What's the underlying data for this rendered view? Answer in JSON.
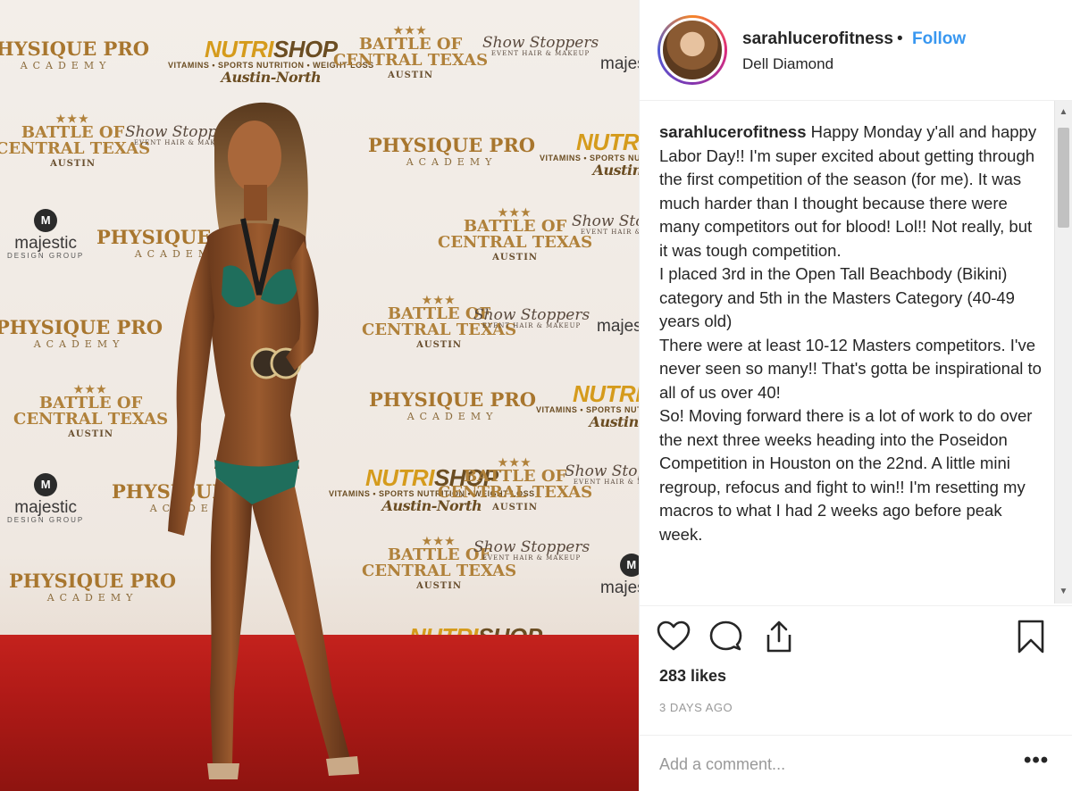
{
  "post": {
    "username": "sarahlucerofitness",
    "separator": "•",
    "follow_label": "Follow",
    "location": "Dell Diamond",
    "caption_user": "sarahlucerofitness",
    "caption_lines": [
      "Happy Monday y'all and happy Labor Day!! I'm super excited about getting through the first competition of the season (for me). It was much harder than I thought because there were many competitors out for blood! Lol!! Not really, but it was tough competition.",
      "I placed 3rd in the Open Tall Beachbody (Bikini) category and 5th in the Masters Category (40-49 years old)",
      "There were at least 10-12 Masters competitors. I've never seen so many!! That's gotta be inspirational to all of us over 40!",
      "So! Moving forward there is a lot of work to do over the next three weeks heading into the Poseidon Competition in Houston on the 22nd. A little mini regroup, refocus and fight to win!! I'm resetting my macros to what I had 2 weeks ago before peak week."
    ],
    "likes": "283 likes",
    "timestamp": "3 DAYS AGO",
    "comment_placeholder": "Add a comment...",
    "more_label": "•••"
  },
  "backdrop_logos": {
    "physique": "PHYSIQUE PRO",
    "physique_sub": "ACADEMY",
    "nutri_a": "NUTRI",
    "nutri_b": "SHOP",
    "nutri_sub": "VITAMINS • SPORTS NUTRITION • WEIGHT LOSS",
    "nutri_city": "Austin-North",
    "battle_stars": "★★★",
    "battle_line1": "BATTLE OF",
    "battle_line2": "CENTRAL TEXAS",
    "battle_sub": "AUSTIN",
    "show": "Show Stoppers",
    "show_sub": "EVENT HAIR & MAKEUP",
    "majestic": "majestic",
    "majestic_mark": "M",
    "majestic_sub": "DESIGN GROUP"
  },
  "icons": {
    "heart": "heart-icon",
    "comment": "comment-icon",
    "share": "share-icon",
    "bookmark": "bookmark-icon",
    "more": "more-icon"
  },
  "colors": {
    "follow": "#3897f0",
    "text": "#262626",
    "muted": "#999999",
    "carpet": "#b01a17",
    "gold": "#b0813a"
  }
}
